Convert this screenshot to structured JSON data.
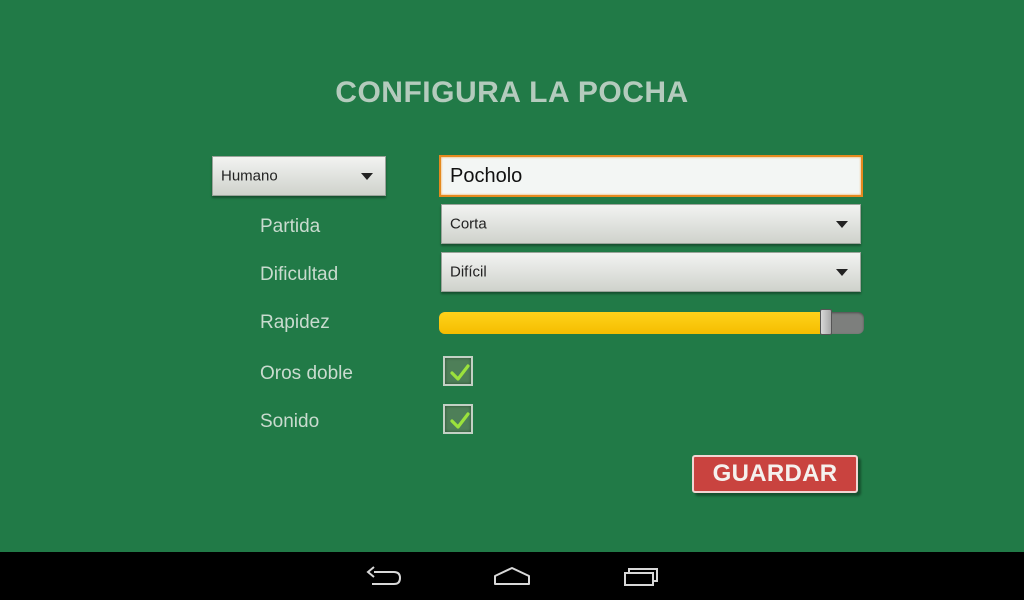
{
  "screen": {
    "title": "CONFIGURA LA POCHA"
  },
  "player": {
    "type_value": "Humano",
    "name_value": "Pocholo"
  },
  "settings": {
    "partida": {
      "label": "Partida",
      "value": "Corta"
    },
    "dificultad": {
      "label": "Dificultad",
      "value": "Difícil"
    },
    "rapidez": {
      "label": "Rapidez",
      "level_percent": 91
    },
    "oros_doble": {
      "label": "Oros doble",
      "checked": true
    },
    "sonido": {
      "label": "Sonido",
      "checked": true
    }
  },
  "actions": {
    "save_label": "GUARDAR"
  },
  "navbar": {
    "icons": [
      "back-icon",
      "home-icon",
      "recent-apps-icon"
    ]
  },
  "colors": {
    "background": "#217a47",
    "slider_fill": "#f5bd00",
    "save_button": "#c9433f",
    "input_focus_border": "#e58a1f"
  }
}
